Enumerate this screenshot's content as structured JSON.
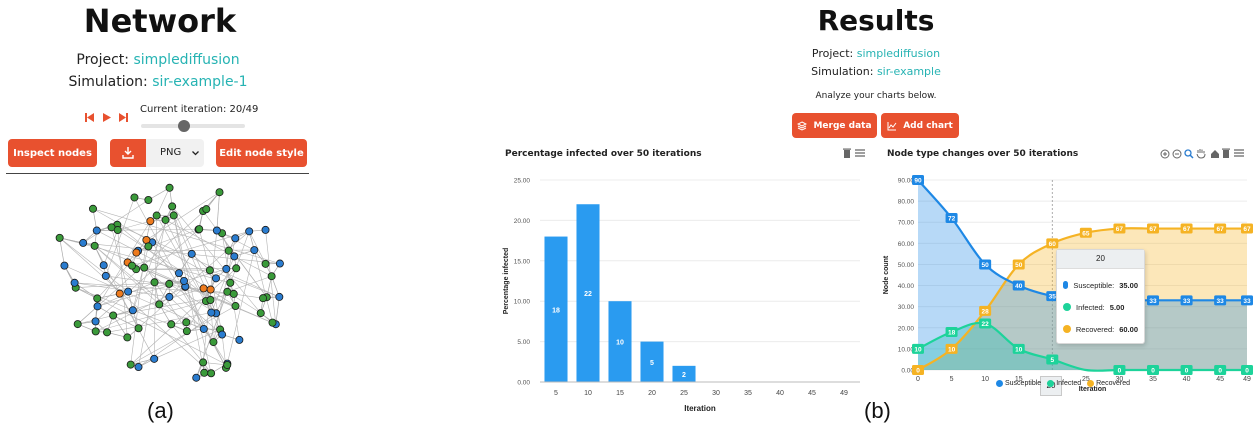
{
  "network": {
    "title": "Network",
    "project_label": "Project:",
    "project_value": "simplediffusion",
    "simulation_label": "Simulation:",
    "simulation_value": "sir-example-1",
    "iteration_text": "Current iteration: 20/49",
    "iteration_progress": 0.41,
    "inspect_button": "Inspect nodes",
    "format_value": "PNG",
    "edit_style_button": "Edit node style",
    "node_colors": {
      "blue": "#2a7ccf",
      "green": "#3a9a3a",
      "orange": "#ee7b1e"
    },
    "caption": "(a)"
  },
  "results": {
    "title": "Results",
    "project_label": "Project:",
    "project_value": "simplediffusion",
    "simulation_label": "Simulation:",
    "simulation_value": "sir-example",
    "analyze_text": "Analyze your charts below.",
    "merge_button": "Merge data",
    "add_chart_button": "Add chart",
    "caption": "(b)"
  },
  "chart_data": [
    {
      "type": "bar",
      "title": "Percentage infected over 50 iterations",
      "xlabel": "Iteration",
      "ylabel": "Percentage infected",
      "categories": [
        "5",
        "10",
        "15",
        "20",
        "25",
        "30",
        "35",
        "40",
        "45",
        "49"
      ],
      "values": [
        18,
        22,
        10,
        5,
        2,
        null,
        null,
        null,
        null,
        null
      ],
      "ylim": [
        0,
        25
      ],
      "yticks": [
        "0.00",
        "5.00",
        "10.00",
        "15.00",
        "20.00",
        "25.00"
      ],
      "color": "#2a9bf0"
    },
    {
      "type": "area",
      "title": "Node type changes over 50 iterations",
      "xlabel": "Iteration",
      "ylabel": "Node count",
      "x": [
        0,
        5,
        10,
        15,
        20,
        25,
        30,
        35,
        40,
        45,
        49
      ],
      "xticks": [
        "0",
        "5",
        "10",
        "15",
        "20",
        "25",
        "30",
        "35",
        "40",
        "45",
        "49"
      ],
      "ylim": [
        0,
        90
      ],
      "yticks": [
        "0.00",
        "10.00",
        "20.00",
        "30.00",
        "40.00",
        "50.00",
        "60.00",
        "70.00",
        "80.00",
        "90.00"
      ],
      "series": [
        {
          "name": "Susceptible",
          "color": "#1e88e5",
          "values": [
            90,
            72,
            50,
            40,
            35,
            33,
            33,
            33,
            33,
            33,
            33
          ],
          "labels": [
            "90",
            "72",
            "50",
            "40",
            "35",
            "",
            "33",
            "33",
            "33",
            "33",
            "33"
          ]
        },
        {
          "name": "Infected",
          "color": "#1dd39a",
          "values": [
            10,
            18,
            22,
            10,
            5,
            0,
            0,
            0,
            0,
            0,
            0
          ],
          "labels": [
            "10",
            "18",
            "22",
            "10",
            "5",
            "",
            "0",
            "0",
            "0",
            "0",
            "0"
          ]
        },
        {
          "name": "Recovered",
          "color": "#f5b324",
          "values": [
            0,
            10,
            28,
            50,
            60,
            65,
            67,
            67,
            67,
            67,
            67
          ],
          "labels": [
            "0",
            "10",
            "28",
            "50",
            "60",
            "65",
            "67",
            "67",
            "67",
            "67",
            "67"
          ]
        }
      ],
      "tooltip": {
        "header": "20",
        "rows": [
          {
            "label": "Susceptible:",
            "value": "35.00",
            "color": "#1e88e5"
          },
          {
            "label": "Infected:",
            "value": "5.00",
            "color": "#1dd39a"
          },
          {
            "label": "Recovered:",
            "value": "60.00",
            "color": "#f5b324"
          }
        ]
      },
      "hover_x_label": "20",
      "legend_position": "bottom"
    }
  ]
}
